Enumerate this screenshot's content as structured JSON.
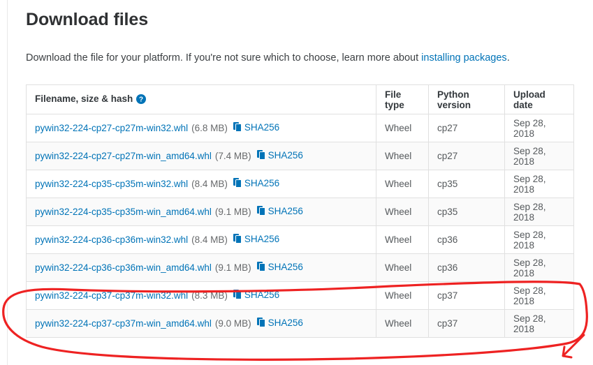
{
  "page": {
    "title": "Download files",
    "intro_prefix": "Download the file for your platform. If you're not sure which to choose, learn more about ",
    "intro_link": "installing packages",
    "intro_suffix": "."
  },
  "table": {
    "headers": {
      "filename": "Filename, size & hash",
      "filetype": "File type",
      "pyversion": "Python version",
      "uploaddate": "Upload date"
    },
    "help_icon": "help-circle-icon",
    "copy_icon": "copy-hash-icon",
    "rows": [
      {
        "filename": "pywin32-224-cp27-cp27m-win32.whl",
        "size": "(6.8 MB)",
        "hash_label": "SHA256",
        "filetype": "Wheel",
        "pyversion": "cp27",
        "uploaddate": "Sep 28, 2018"
      },
      {
        "filename": "pywin32-224-cp27-cp27m-win_amd64.whl",
        "size": "(7.4 MB)",
        "hash_label": "SHA256",
        "filetype": "Wheel",
        "pyversion": "cp27",
        "uploaddate": "Sep 28, 2018"
      },
      {
        "filename": "pywin32-224-cp35-cp35m-win32.whl",
        "size": "(8.4 MB)",
        "hash_label": "SHA256",
        "filetype": "Wheel",
        "pyversion": "cp35",
        "uploaddate": "Sep 28, 2018"
      },
      {
        "filename": "pywin32-224-cp35-cp35m-win_amd64.whl",
        "size": "(9.1 MB)",
        "hash_label": "SHA256",
        "filetype": "Wheel",
        "pyversion": "cp35",
        "uploaddate": "Sep 28, 2018"
      },
      {
        "filename": "pywin32-224-cp36-cp36m-win32.whl",
        "size": "(8.4 MB)",
        "hash_label": "SHA256",
        "filetype": "Wheel",
        "pyversion": "cp36",
        "uploaddate": "Sep 28, 2018"
      },
      {
        "filename": "pywin32-224-cp36-cp36m-win_amd64.whl",
        "size": "(9.1 MB)",
        "hash_label": "SHA256",
        "filetype": "Wheel",
        "pyversion": "cp36",
        "uploaddate": "Sep 28, 2018"
      },
      {
        "filename": "pywin32-224-cp37-cp37m-win32.whl",
        "size": "(8.3 MB)",
        "hash_label": "SHA256",
        "filetype": "Wheel",
        "pyversion": "cp37",
        "uploaddate": "Sep 28, 2018"
      },
      {
        "filename": "pywin32-224-cp37-cp37m-win_amd64.whl",
        "size": "(9.0 MB)",
        "hash_label": "SHA256",
        "filetype": "Wheel",
        "pyversion": "cp37",
        "uploaddate": "Sep 28, 2018"
      }
    ]
  },
  "annotation": {
    "name": "red-highlight-ellipse",
    "color": "#ee2222",
    "description": "hand-drawn red loop around the two cp37 rows"
  },
  "colors": {
    "link": "#0073b7",
    "text": "#2b2b2b",
    "muted": "#67696b",
    "border": "#e0e0e0",
    "row_alt": "#fafafa",
    "annotation_red": "#ee2222"
  }
}
